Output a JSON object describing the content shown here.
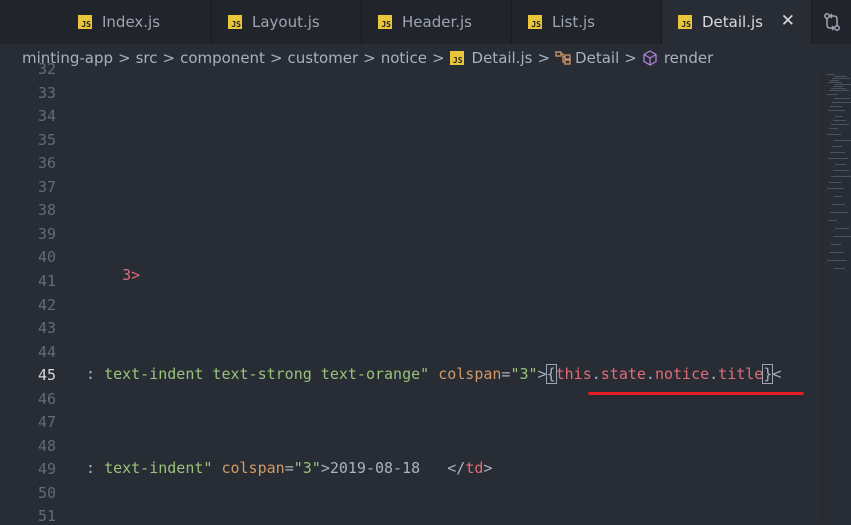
{
  "tabs": [
    {
      "label": "Index.js",
      "icon": "js-file-icon",
      "active": false
    },
    {
      "label": "Layout.js",
      "icon": "js-file-icon",
      "active": false
    },
    {
      "label": "Header.js",
      "icon": "js-file-icon",
      "active": false
    },
    {
      "label": "List.js",
      "icon": "js-file-icon",
      "active": false
    },
    {
      "label": "Detail.js",
      "icon": "js-file-icon",
      "active": true
    }
  ],
  "js_icon_text": "JS",
  "close_glyph": "✕",
  "breadcrumb": {
    "items": [
      "minting-app",
      "src",
      "component",
      "customer",
      "notice",
      "Detail.js",
      "Detail",
      "render"
    ],
    "separator": ">"
  },
  "editor": {
    "line_numbers": [
      "32",
      "33",
      "34",
      "35",
      "36",
      "37",
      "38",
      "39",
      "40",
      "41",
      "42",
      "43",
      "44",
      "45",
      "46",
      "47",
      "48",
      "49",
      "50",
      "51"
    ],
    "current_line": "45",
    "line40": {
      "tag": "3>"
    },
    "line45": {
      "attr_start": ": ",
      "class_value": "text-indent text-strong text-orange\"",
      "colspan_attr": " colspan",
      "eq": "=",
      "colspan_value": "\"3\"",
      "gt": ">",
      "open_brace": "{",
      "expr_this": "this",
      "dot": ".",
      "expr_state": "state",
      "expr_notice": "notice",
      "expr_title": "title",
      "close_brace": "}",
      "tail": "<"
    },
    "line49": {
      "attr_start": ": ",
      "class_value": "text-indent\"",
      "colspan_attr": " colspan",
      "eq": "=",
      "colspan_value": "\"3\"",
      "gt": ">",
      "date": "2019-08-18",
      "gap": "   ",
      "close_open": "</",
      "close_tag": "td",
      "close_gt": ">"
    }
  },
  "colors": {
    "accent_underline": "#e51c23",
    "js_icon": "#e8c53a"
  }
}
